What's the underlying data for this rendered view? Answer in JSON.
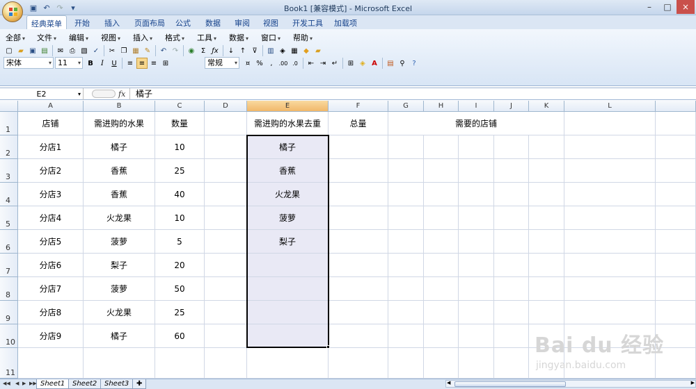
{
  "window": {
    "title": "Book1  [兼容模式]  -  Microsoft Excel"
  },
  "tabs": [
    "经典菜单",
    "开始",
    "插入",
    "页面布局",
    "公式",
    "数据",
    "审阅",
    "视图",
    "开发工具",
    "加载项"
  ],
  "menus": [
    "全部",
    "文件",
    "编辑",
    "视图",
    "插入",
    "格式",
    "工具",
    "数据",
    "窗口",
    "帮助"
  ],
  "toolbar": {
    "font_name": "宋体",
    "font_size": "11",
    "number_format": "常规"
  },
  "formula": {
    "name_box": "E2",
    "fx": "fx",
    "content": "橘子"
  },
  "columns": [
    "A",
    "B",
    "C",
    "D",
    "E",
    "F",
    "G",
    "H",
    "I",
    "J",
    "K",
    "L"
  ],
  "rows": [
    "1",
    "2",
    "3",
    "4",
    "5",
    "6",
    "7",
    "8",
    "9",
    "10",
    "11"
  ],
  "cells": {
    "A": [
      "店铺",
      "分店1",
      "分店2",
      "分店3",
      "分店4",
      "分店5",
      "分店6",
      "分店7",
      "分店8",
      "分店9",
      ""
    ],
    "B": [
      "需进购的水果",
      "橘子",
      "香蕉",
      "香蕉",
      "火龙果",
      "菠萝",
      "梨子",
      "菠萝",
      "火龙果",
      "橘子",
      ""
    ],
    "C": [
      "数量",
      "10",
      "25",
      "40",
      "10",
      "5",
      "20",
      "50",
      "25",
      "60",
      ""
    ],
    "D": [
      "",
      "",
      "",
      "",
      "",
      "",
      "",
      "",
      "",
      "",
      ""
    ],
    "E": [
      "需进购的水果去重",
      "橘子",
      "香蕉",
      "火龙果",
      "菠萝",
      "梨子",
      "",
      "",
      "",
      "",
      ""
    ],
    "F": [
      "总量",
      "",
      "",
      "",
      "",
      "",
      "",
      "",
      "",
      "",
      ""
    ],
    "GK": [
      "需要的店铺",
      "",
      "",
      "",
      "",
      "",
      "",
      "",
      "",
      "",
      ""
    ]
  },
  "sheets": [
    "Sheet1",
    "Sheet2",
    "Sheet3"
  ],
  "watermark": {
    "brand": "Bai du 经验",
    "url": "jingyan.baidu.com"
  },
  "colors": {
    "selection_header": "#f1b86a",
    "ribbon": "#d8e5f5",
    "selection_fill": "#e9e9f5"
  }
}
